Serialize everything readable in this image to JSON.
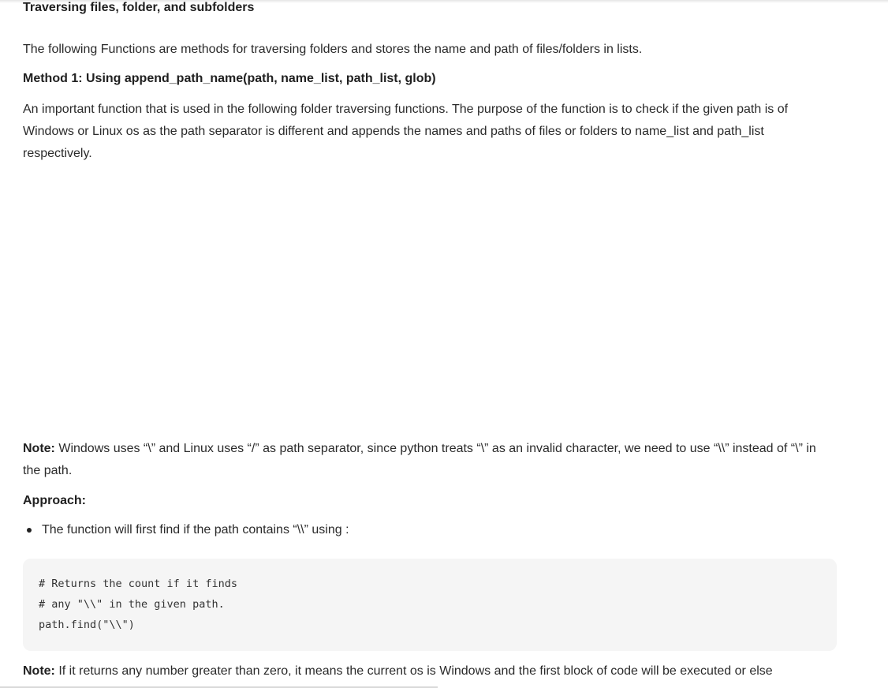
{
  "heading": "Traversing files, folder, and subfolders",
  "intro": "The following Functions are methods for traversing folders and stores the name and path of files/folders in lists.",
  "method": {
    "title": "Method 1: Using append_path_name(path, name_list, path_list, glob)",
    "description": "An important function that is used in the following folder traversing functions. The purpose of the function is to check if the given path is of Windows or Linux os as the path separator is different and appends the names and paths of files or folders to name_list and path_list respectively."
  },
  "note1": {
    "label": "Note:",
    "text": " Windows uses “\\” and Linux uses “/” as path separator, since python treats “\\” as an invalid character, we need to use “\\\\” instead of “\\” in the path."
  },
  "approach": {
    "label": "Approach:",
    "bullets": [
      "The function will first find if the path contains “\\\\” using :"
    ]
  },
  "code": {
    "lines": [
      "# Returns the count if it finds",
      "# any \"\\\\\" in the given path.",
      "path.find(\"\\\\\")"
    ]
  },
  "note2": {
    "label": "Note:",
    "text": " If it returns any number greater than zero, it means the current os is Windows and the first block of code will be executed or else"
  }
}
